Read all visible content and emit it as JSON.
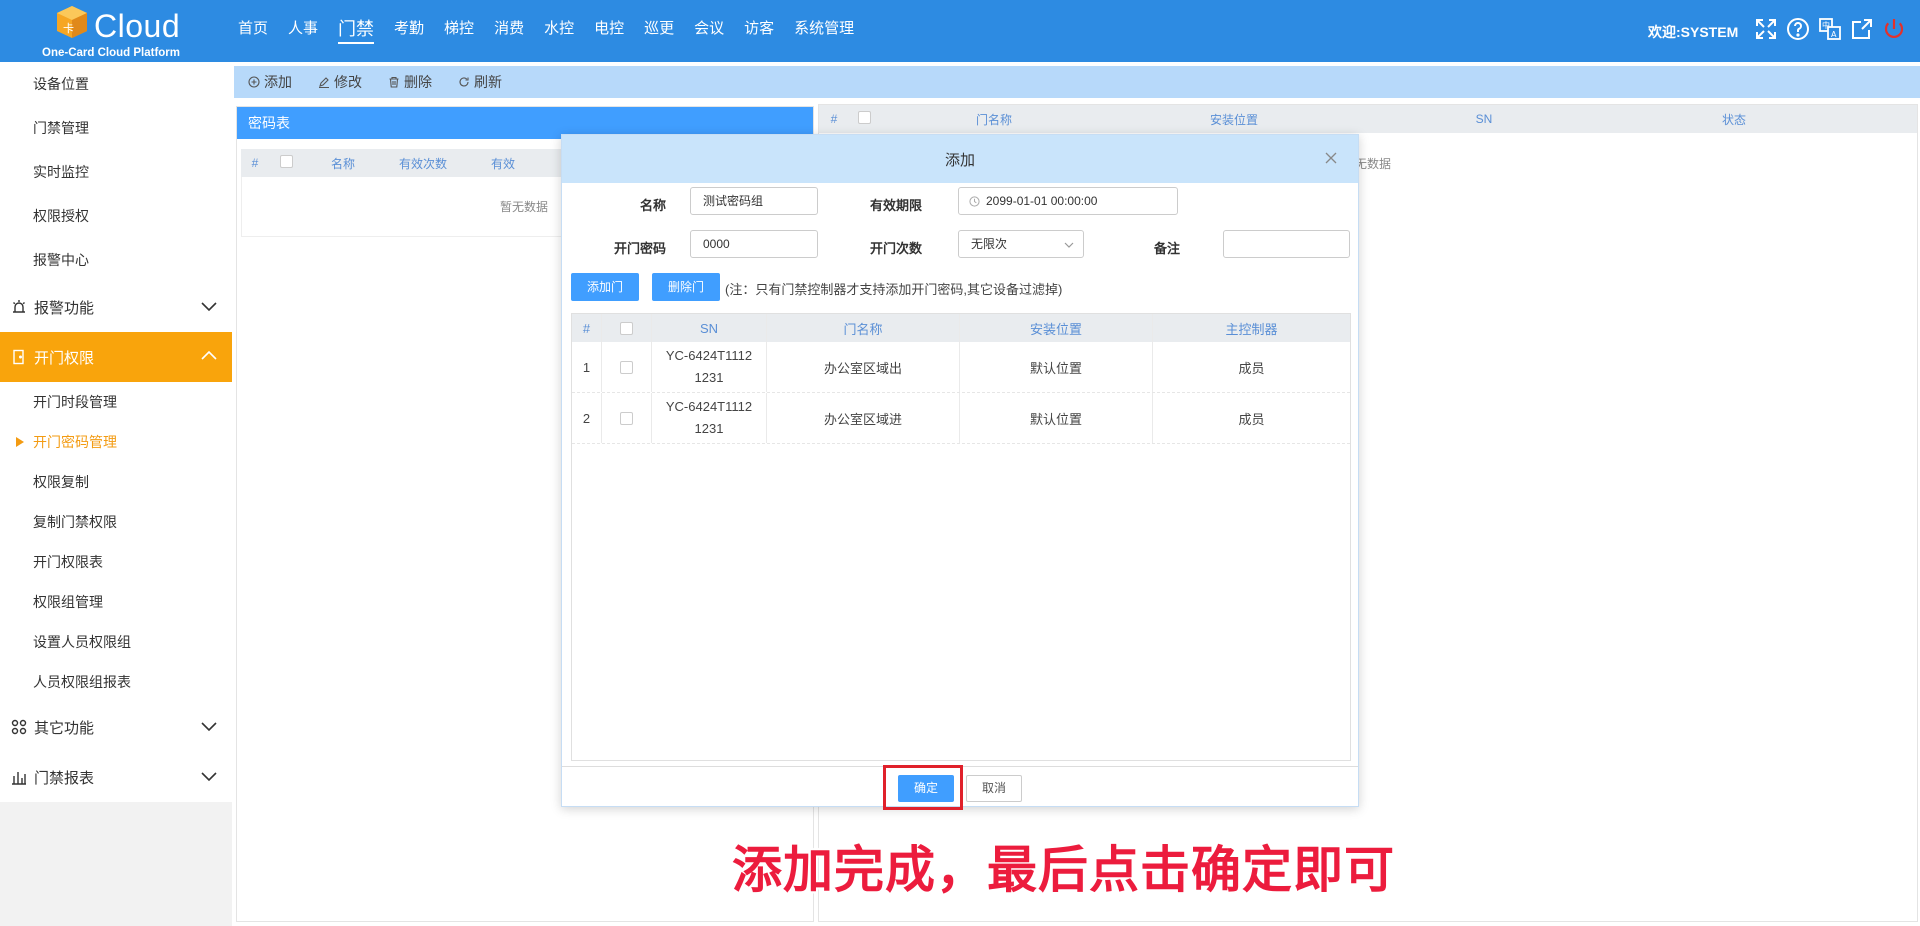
{
  "header": {
    "logo_word": "Cloud",
    "logo_sub": "One-Card Cloud Platform",
    "nav": [
      "首页",
      "人事",
      "门禁",
      "考勤",
      "梯控",
      "消费",
      "水控",
      "电控",
      "巡更",
      "会议",
      "访客",
      "系统管理"
    ],
    "active_nav": "门禁",
    "welcome": "欢迎:SYSTEM",
    "icons": [
      "fullscreen-icon",
      "help-icon",
      "translate-icon",
      "external-link-icon",
      "power-icon"
    ]
  },
  "sidebar": {
    "top_items": [
      "设备位置",
      "门禁管理",
      "实时监控",
      "权限授权",
      "报警中心"
    ],
    "group_alarm": "报警功能",
    "group_permission": "开门权限",
    "permission_items": [
      "开门时段管理",
      "开门密码管理",
      "权限复制",
      "复制门禁权限",
      "开门权限表",
      "权限组管理",
      "设置人员权限组",
      "人员权限组报表"
    ],
    "group_other": "其它功能",
    "group_report": "门禁报表"
  },
  "toolbar": {
    "add": "添加",
    "edit": "修改",
    "delete": "删除",
    "refresh": "刷新"
  },
  "left_panel": {
    "title": "密码表",
    "columns": [
      "#",
      "名称",
      "有效次数",
      "有效"
    ],
    "empty": "暂无数据"
  },
  "right_panel": {
    "columns": [
      "#",
      "门名称",
      "安装位置",
      "SN",
      "状态"
    ],
    "empty": "无数据"
  },
  "dialog": {
    "title": "添加",
    "name_label": "名称",
    "name_value": "测试密码组",
    "valid_label": "有效期限",
    "valid_value": "2099-01-01 00:00:00",
    "pwd_label": "开门密码",
    "pwd_value": "0000",
    "count_label": "开门次数",
    "count_value": "无限次",
    "remark_label": "备注",
    "remark_value": "",
    "add_door": "添加门",
    "del_door": "删除门",
    "note": "(注：只有门禁控制器才支持添加开门密码,其它设备过滤掉)",
    "columns": [
      "#",
      "",
      "SN",
      "门名称",
      "安装位置",
      "主控制器"
    ],
    "rows": [
      {
        "idx": "1",
        "sn1": "YC-6424T1112",
        "sn2": "1231",
        "door": "办公室区域出",
        "location": "默认位置",
        "controller": "成员"
      },
      {
        "idx": "2",
        "sn1": "YC-6424T1112",
        "sn2": "1231",
        "door": "办公室区域进",
        "location": "默认位置",
        "controller": "成员"
      }
    ],
    "ok": "确定",
    "cancel": "取消"
  },
  "caption": "添加完成，最后点击确定即可",
  "colors": {
    "header": "#2d8be2",
    "accent_orange": "#f9a40c",
    "primary_blue": "#409eff",
    "caption_red": "#ec1c3d"
  }
}
